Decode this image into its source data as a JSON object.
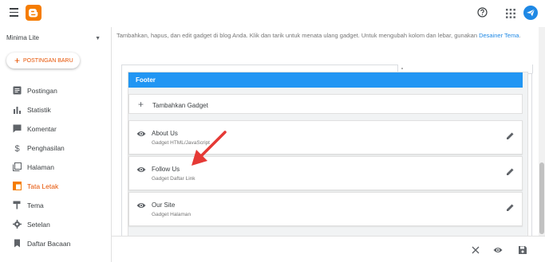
{
  "topbar": {
    "menu_icon": "hamburger-menu-icon",
    "logo": "blogger-logo",
    "help_icon": "help-circle-icon",
    "apps_icon": "apps-grid-icon",
    "avatar_icon": "paper-plane-avatar-icon"
  },
  "sidebar": {
    "blog_name": "Minima Lite",
    "new_post_label": "POSTINGAN BARU",
    "items": [
      {
        "label": "Postingan",
        "icon": "posts-icon"
      },
      {
        "label": "Statistik",
        "icon": "stats-icon"
      },
      {
        "label": "Komentar",
        "icon": "comment-icon"
      },
      {
        "label": "Penghasilan",
        "icon": "dollar-icon"
      },
      {
        "label": "Halaman",
        "icon": "pages-icon"
      },
      {
        "label": "Tata Letak",
        "icon": "layout-icon"
      },
      {
        "label": "Tema",
        "icon": "theme-roller-icon"
      },
      {
        "label": "Setelan",
        "icon": "gear-icon"
      },
      {
        "label": "Daftar Bacaan",
        "icon": "bookmark-icon"
      }
    ],
    "active_item": "Tata Letak"
  },
  "main": {
    "intro_text": "Tambahkan, hapus, dan edit gadget di blog Anda. Klik dan tarik untuk menata ulang gadget. Untuk mengubah kolom dan lebar, gunakan ",
    "intro_link": "Desainer Tema",
    "intro_end": ".",
    "section_title": "Footer",
    "add_gadget_label": "Tambahkan Gadget",
    "gadgets": [
      {
        "title": "About Us",
        "subtitle": "Gadget HTML/JavaScript"
      },
      {
        "title": "Follow Us",
        "subtitle": "Gadget Daftar Link"
      },
      {
        "title": "Our Site",
        "subtitle": "Gadget Halaman"
      }
    ]
  },
  "bottom_bar": {
    "close_icon": "close-icon",
    "preview_icon": "eye-icon",
    "save_icon": "save-icon"
  },
  "colors": {
    "accent": "#f57c00",
    "header_blue": "#2196f3",
    "link_blue": "#1e88e5",
    "arrow_red": "#e53935"
  }
}
